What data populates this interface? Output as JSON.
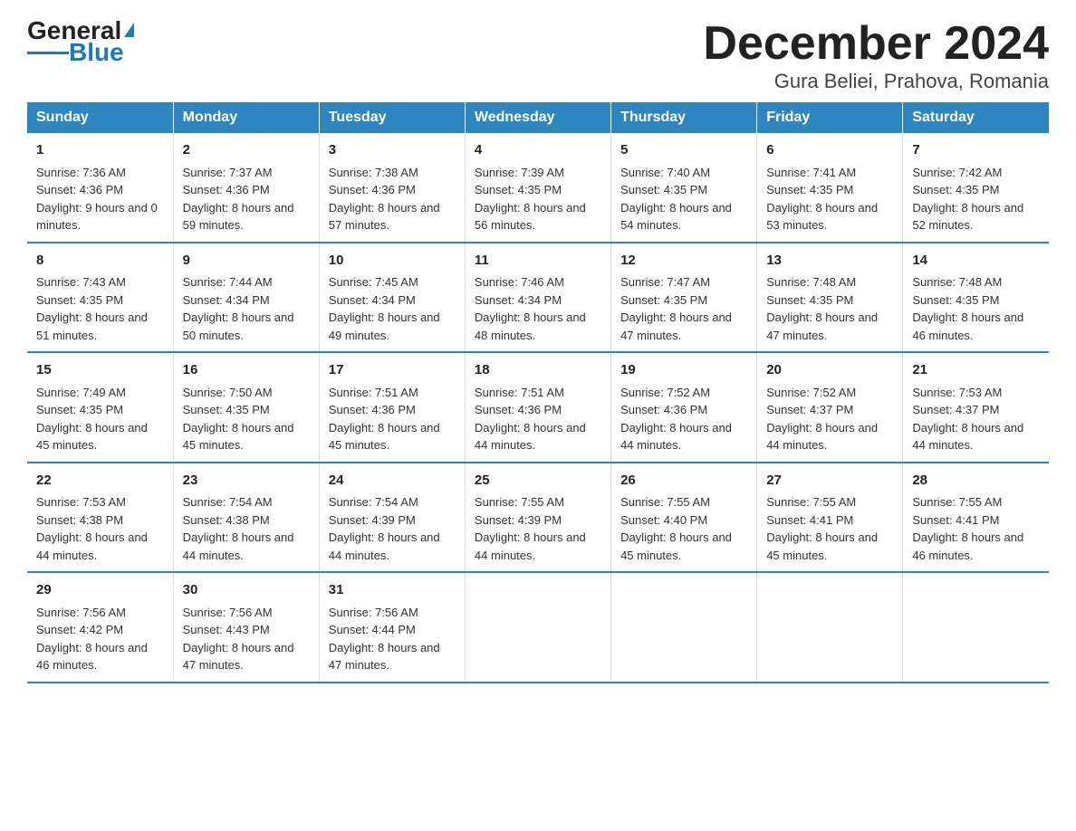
{
  "logo": {
    "text_general": "General",
    "text_blue": "Blue"
  },
  "title": "December 2024",
  "subtitle": "Gura Beliei, Prahova, Romania",
  "days_of_week": [
    "Sunday",
    "Monday",
    "Tuesday",
    "Wednesday",
    "Thursday",
    "Friday",
    "Saturday"
  ],
  "weeks": [
    [
      {
        "day": "1",
        "sunrise": "7:36 AM",
        "sunset": "4:36 PM",
        "daylight": "9 hours and 0 minutes."
      },
      {
        "day": "2",
        "sunrise": "7:37 AM",
        "sunset": "4:36 PM",
        "daylight": "8 hours and 59 minutes."
      },
      {
        "day": "3",
        "sunrise": "7:38 AM",
        "sunset": "4:36 PM",
        "daylight": "8 hours and 57 minutes."
      },
      {
        "day": "4",
        "sunrise": "7:39 AM",
        "sunset": "4:35 PM",
        "daylight": "8 hours and 56 minutes."
      },
      {
        "day": "5",
        "sunrise": "7:40 AM",
        "sunset": "4:35 PM",
        "daylight": "8 hours and 54 minutes."
      },
      {
        "day": "6",
        "sunrise": "7:41 AM",
        "sunset": "4:35 PM",
        "daylight": "8 hours and 53 minutes."
      },
      {
        "day": "7",
        "sunrise": "7:42 AM",
        "sunset": "4:35 PM",
        "daylight": "8 hours and 52 minutes."
      }
    ],
    [
      {
        "day": "8",
        "sunrise": "7:43 AM",
        "sunset": "4:35 PM",
        "daylight": "8 hours and 51 minutes."
      },
      {
        "day": "9",
        "sunrise": "7:44 AM",
        "sunset": "4:34 PM",
        "daylight": "8 hours and 50 minutes."
      },
      {
        "day": "10",
        "sunrise": "7:45 AM",
        "sunset": "4:34 PM",
        "daylight": "8 hours and 49 minutes."
      },
      {
        "day": "11",
        "sunrise": "7:46 AM",
        "sunset": "4:34 PM",
        "daylight": "8 hours and 48 minutes."
      },
      {
        "day": "12",
        "sunrise": "7:47 AM",
        "sunset": "4:35 PM",
        "daylight": "8 hours and 47 minutes."
      },
      {
        "day": "13",
        "sunrise": "7:48 AM",
        "sunset": "4:35 PM",
        "daylight": "8 hours and 47 minutes."
      },
      {
        "day": "14",
        "sunrise": "7:48 AM",
        "sunset": "4:35 PM",
        "daylight": "8 hours and 46 minutes."
      }
    ],
    [
      {
        "day": "15",
        "sunrise": "7:49 AM",
        "sunset": "4:35 PM",
        "daylight": "8 hours and 45 minutes."
      },
      {
        "day": "16",
        "sunrise": "7:50 AM",
        "sunset": "4:35 PM",
        "daylight": "8 hours and 45 minutes."
      },
      {
        "day": "17",
        "sunrise": "7:51 AM",
        "sunset": "4:36 PM",
        "daylight": "8 hours and 45 minutes."
      },
      {
        "day": "18",
        "sunrise": "7:51 AM",
        "sunset": "4:36 PM",
        "daylight": "8 hours and 44 minutes."
      },
      {
        "day": "19",
        "sunrise": "7:52 AM",
        "sunset": "4:36 PM",
        "daylight": "8 hours and 44 minutes."
      },
      {
        "day": "20",
        "sunrise": "7:52 AM",
        "sunset": "4:37 PM",
        "daylight": "8 hours and 44 minutes."
      },
      {
        "day": "21",
        "sunrise": "7:53 AM",
        "sunset": "4:37 PM",
        "daylight": "8 hours and 44 minutes."
      }
    ],
    [
      {
        "day": "22",
        "sunrise": "7:53 AM",
        "sunset": "4:38 PM",
        "daylight": "8 hours and 44 minutes."
      },
      {
        "day": "23",
        "sunrise": "7:54 AM",
        "sunset": "4:38 PM",
        "daylight": "8 hours and 44 minutes."
      },
      {
        "day": "24",
        "sunrise": "7:54 AM",
        "sunset": "4:39 PM",
        "daylight": "8 hours and 44 minutes."
      },
      {
        "day": "25",
        "sunrise": "7:55 AM",
        "sunset": "4:39 PM",
        "daylight": "8 hours and 44 minutes."
      },
      {
        "day": "26",
        "sunrise": "7:55 AM",
        "sunset": "4:40 PM",
        "daylight": "8 hours and 45 minutes."
      },
      {
        "day": "27",
        "sunrise": "7:55 AM",
        "sunset": "4:41 PM",
        "daylight": "8 hours and 45 minutes."
      },
      {
        "day": "28",
        "sunrise": "7:55 AM",
        "sunset": "4:41 PM",
        "daylight": "8 hours and 46 minutes."
      }
    ],
    [
      {
        "day": "29",
        "sunrise": "7:56 AM",
        "sunset": "4:42 PM",
        "daylight": "8 hours and 46 minutes."
      },
      {
        "day": "30",
        "sunrise": "7:56 AM",
        "sunset": "4:43 PM",
        "daylight": "8 hours and 47 minutes."
      },
      {
        "day": "31",
        "sunrise": "7:56 AM",
        "sunset": "4:44 PM",
        "daylight": "8 hours and 47 minutes."
      },
      null,
      null,
      null,
      null
    ]
  ]
}
